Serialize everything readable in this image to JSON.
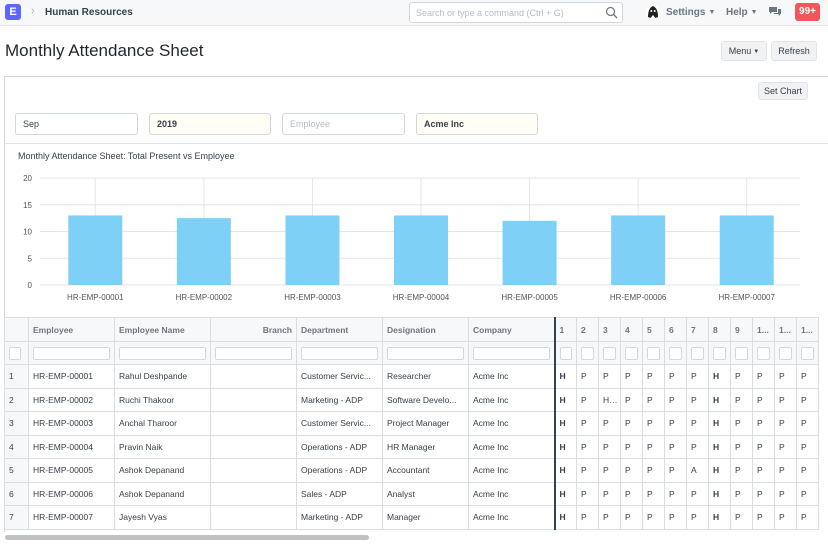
{
  "navbar": {
    "logo": "E",
    "breadcrumb": "Human Resources",
    "search_placeholder": "Search or type a command (Ctrl + G)",
    "settings_label": "Settings",
    "help_label": "Help",
    "notification_count": "99+"
  },
  "page": {
    "title": "Monthly Attendance Sheet",
    "menu_label": "Menu",
    "refresh_label": "Refresh",
    "set_chart_label": "Set Chart"
  },
  "filters": {
    "month": "Sep",
    "year": "2019",
    "employee_placeholder": "Employee",
    "company": "Acme Inc"
  },
  "chart_data": {
    "type": "bar",
    "title": "Monthly Attendance Sheet: Total Present vs Employee",
    "categories": [
      "HR-EMP-00001",
      "HR-EMP-00002",
      "HR-EMP-00003",
      "HR-EMP-00004",
      "HR-EMP-00005",
      "HR-EMP-00006",
      "HR-EMP-00007"
    ],
    "values": [
      13,
      12.5,
      13,
      13,
      12,
      13,
      13
    ],
    "yticks": [
      0,
      5,
      10,
      15,
      20
    ],
    "ylim": [
      0,
      20
    ],
    "color": "#7fd0f7",
    "grid": true
  },
  "table": {
    "columns": [
      "Employee",
      "Employee Name",
      "Branch",
      "Department",
      "Designation",
      "Company",
      "1",
      "2",
      "3",
      "4",
      "5",
      "6",
      "7",
      "8",
      "9",
      "1...",
      "1...",
      "1..."
    ],
    "rows": [
      {
        "num": "1",
        "cells": [
          "HR-EMP-00001",
          "Rahul Deshpande",
          "",
          "Customer Servic...",
          "Researcher",
          "Acme Inc",
          "H",
          "P",
          "P",
          "P",
          "P",
          "P",
          "P",
          "H",
          "P",
          "P",
          "P",
          "P"
        ]
      },
      {
        "num": "2",
        "cells": [
          "HR-EMP-00002",
          "Ruchi Thakoor",
          "",
          "Marketing - ADP",
          "Software Develo...",
          "Acme Inc",
          "H",
          "P",
          "H...",
          "P",
          "P",
          "P",
          "P",
          "H",
          "P",
          "P",
          "P",
          "P"
        ]
      },
      {
        "num": "3",
        "cells": [
          "HR-EMP-00003",
          "Anchal Tharoor",
          "",
          "Customer Servic...",
          "Project Manager",
          "Acme Inc",
          "H",
          "P",
          "P",
          "P",
          "P",
          "P",
          "P",
          "H",
          "P",
          "P",
          "P",
          "P"
        ]
      },
      {
        "num": "4",
        "cells": [
          "HR-EMP-00004",
          "Pravin Naik",
          "",
          "Operations - ADP",
          "HR Manager",
          "Acme Inc",
          "H",
          "P",
          "P",
          "P",
          "P",
          "P",
          "P",
          "H",
          "P",
          "P",
          "P",
          "P"
        ]
      },
      {
        "num": "5",
        "cells": [
          "HR-EMP-00005",
          "Ashok Depanand",
          "",
          "Operations - ADP",
          "Accountant",
          "Acme Inc",
          "H",
          "P",
          "P",
          "P",
          "P",
          "P",
          "A",
          "H",
          "P",
          "P",
          "P",
          "P"
        ]
      },
      {
        "num": "6",
        "cells": [
          "HR-EMP-00006",
          "Ashok Depanand",
          "",
          "Sales - ADP",
          "Analyst",
          "Acme Inc",
          "H",
          "P",
          "P",
          "P",
          "P",
          "P",
          "P",
          "H",
          "P",
          "P",
          "P",
          "P"
        ]
      },
      {
        "num": "7",
        "cells": [
          "HR-EMP-00007",
          "Jayesh Vyas",
          "",
          "Marketing - ADP",
          "Manager",
          "Acme Inc",
          "H",
          "P",
          "P",
          "P",
          "P",
          "P",
          "P",
          "H",
          "P",
          "P",
          "P",
          "P"
        ]
      }
    ]
  }
}
